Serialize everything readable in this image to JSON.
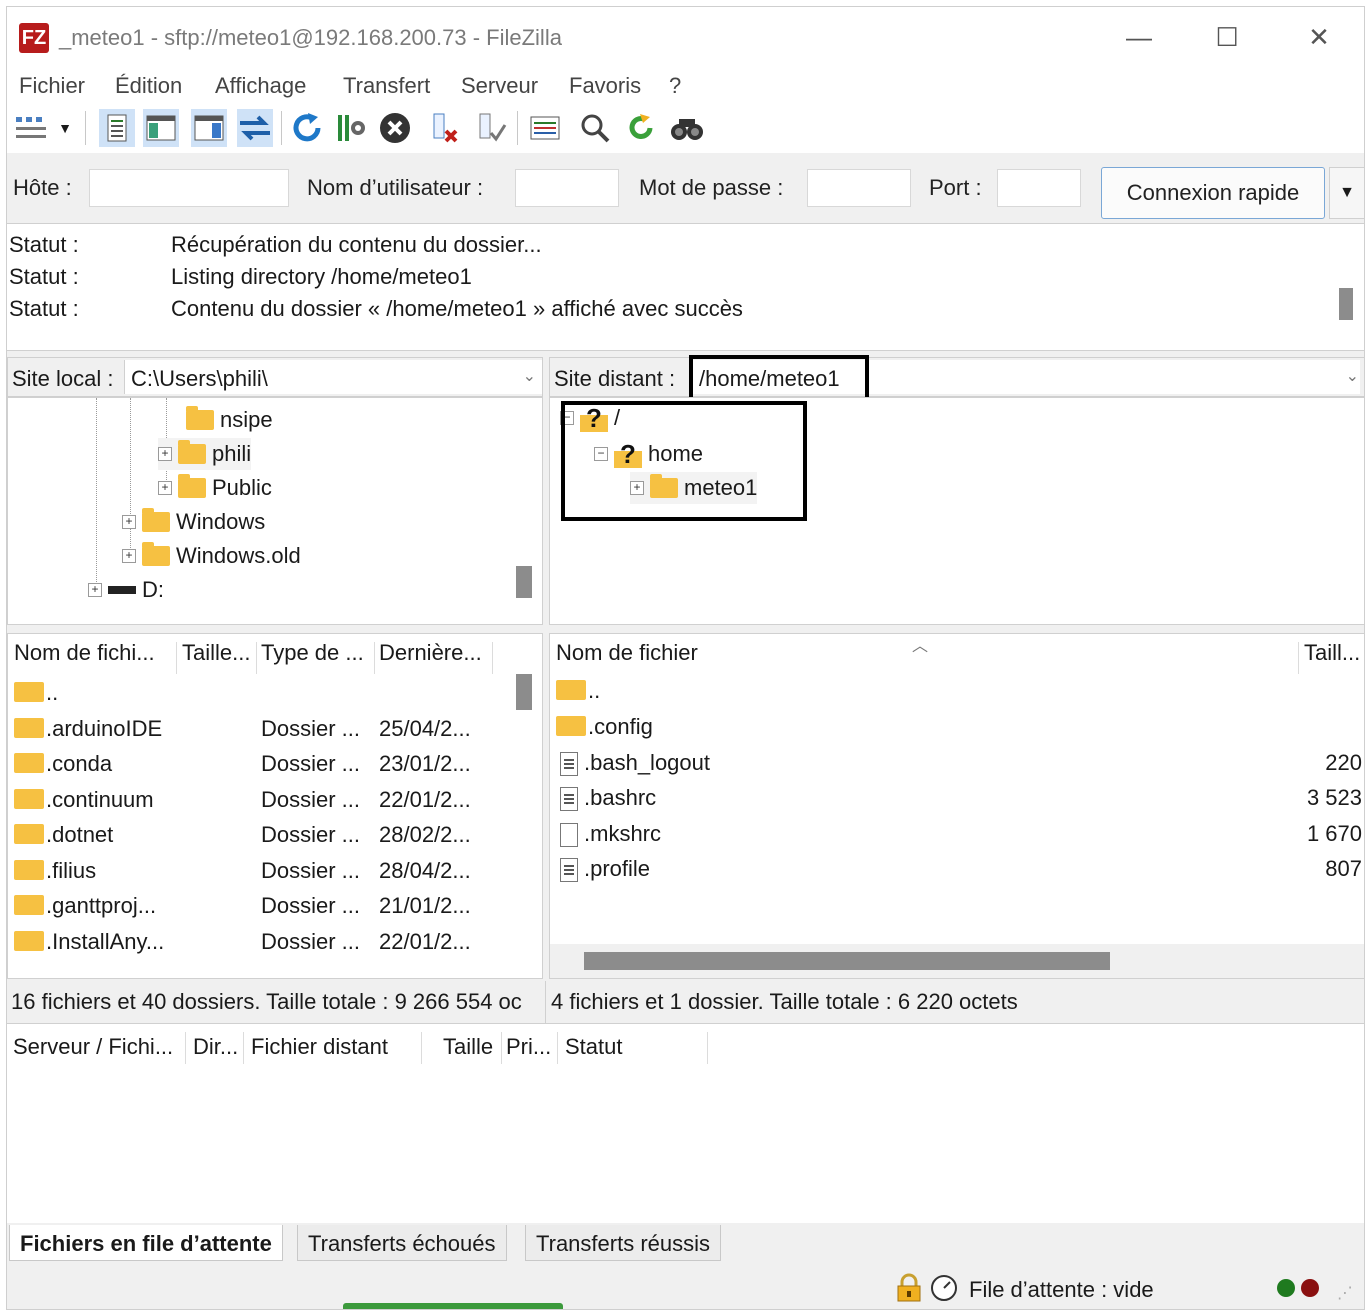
{
  "window": {
    "title": "_meteo1 - sftp://meteo1@192.168.200.73 - FileZilla",
    "logo": "FZ",
    "controls": {
      "minimize": "—",
      "maximize": "☐",
      "close": "✕"
    }
  },
  "menu": [
    "Fichier",
    "Édition",
    "Affichage",
    "Transfert",
    "Serveur",
    "Favoris",
    "?"
  ],
  "quickconnect": {
    "host_label": "Hôte :",
    "user_label": "Nom d’utilisateur :",
    "pass_label": "Mot de passe :",
    "port_label": "Port :",
    "host_value": "",
    "user_value": "",
    "pass_value": "",
    "port_value": "",
    "button": "Connexion rapide",
    "dropdown": "▼"
  },
  "log": [
    {
      "key": "Statut :",
      "value": "Récupération du contenu du dossier..."
    },
    {
      "key": "Statut :",
      "value": "Listing directory /home/meteo1"
    },
    {
      "key": "Statut :",
      "value": "Contenu du dossier « /home/meteo1 » affiché avec succès"
    }
  ],
  "local": {
    "label": "Site local :",
    "path": "C:\\Users\\phili\\",
    "tree": [
      "nsipe",
      "phili",
      "Public",
      "Windows",
      "Windows.old",
      "D:"
    ],
    "headers": [
      "Nom de fichi...",
      "Taille...",
      "Type de ...",
      "Dernière..."
    ],
    "rows": [
      {
        "name": "..",
        "type": "",
        "date": ""
      },
      {
        "name": ".arduinoIDE",
        "type": "Dossier ...",
        "date": "25/04/2..."
      },
      {
        "name": ".conda",
        "type": "Dossier ...",
        "date": "23/01/2..."
      },
      {
        "name": ".continuum",
        "type": "Dossier ...",
        "date": "22/01/2..."
      },
      {
        "name": ".dotnet",
        "type": "Dossier ...",
        "date": "28/02/2..."
      },
      {
        "name": ".filius",
        "type": "Dossier ...",
        "date": "28/04/2..."
      },
      {
        "name": ".ganttproj...",
        "type": "Dossier ...",
        "date": "21/01/2..."
      },
      {
        "name": ".InstallAny...",
        "type": "Dossier ...",
        "date": "22/01/2..."
      }
    ],
    "status": "16 fichiers et 40 dossiers. Taille totale : 9 266 554 oc"
  },
  "remote": {
    "label": "Site distant :",
    "path": "/home/meteo1",
    "tree": [
      "/",
      "home",
      "meteo1"
    ],
    "headers": [
      "Nom de fichier",
      "Taill..."
    ],
    "rows": [
      {
        "name": "..",
        "size": "",
        "icon": "folder"
      },
      {
        "name": ".config",
        "size": "",
        "icon": "folder"
      },
      {
        "name": ".bash_logout",
        "size": "220",
        "icon": "doc"
      },
      {
        "name": ".bashrc",
        "size": "3 523",
        "icon": "doc"
      },
      {
        "name": ".mkshrc",
        "size": "1 670",
        "icon": "blank"
      },
      {
        "name": ".profile",
        "size": "807",
        "icon": "doc"
      }
    ],
    "status": "4 fichiers et 1 dossier. Taille totale : 6 220 octets"
  },
  "queue": {
    "headers": [
      "Serveur / Fichi...",
      "Dir...",
      "Fichier distant",
      "Taille",
      "Pri...",
      "Statut"
    ],
    "tabs": [
      "Fichiers en file d’attente",
      "Transferts échoués",
      "Transferts réussis"
    ],
    "status": "File d’attente : vide"
  },
  "colors": {
    "folder": "#f6c142",
    "accent_border": "#7aa7d6",
    "logo": "#b71c1c"
  }
}
